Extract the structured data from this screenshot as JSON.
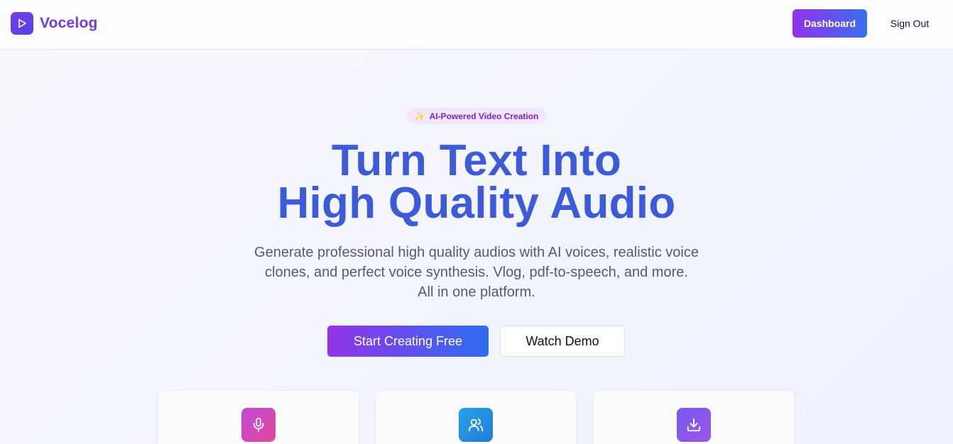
{
  "header": {
    "brand": "Vocelog",
    "dashboard_label": "Dashboard",
    "signout_label": "Sign Out"
  },
  "hero": {
    "badge": "AI-Powered Video Creation",
    "title_line1": "Turn Text Into",
    "title_line2": "High Quality Audio",
    "subtitle_line1": "Generate professional high quality audios with AI voices, realistic voice",
    "subtitle_line2": "clones, and perfect voice synthesis. Vlog, pdf-to-speech, and more.",
    "subtitle_line3": "All in one platform.",
    "primary_cta": "Start Creating Free",
    "secondary_cta": "Watch Demo"
  },
  "features": [
    {
      "icon": "microphone-icon"
    },
    {
      "icon": "users-icon"
    },
    {
      "icon": "download-icon"
    }
  ],
  "colors": {
    "brand": "#6d3be8",
    "title": "#3d5ad9",
    "gradient_start": "#9333ea",
    "gradient_end": "#2f6df0"
  }
}
